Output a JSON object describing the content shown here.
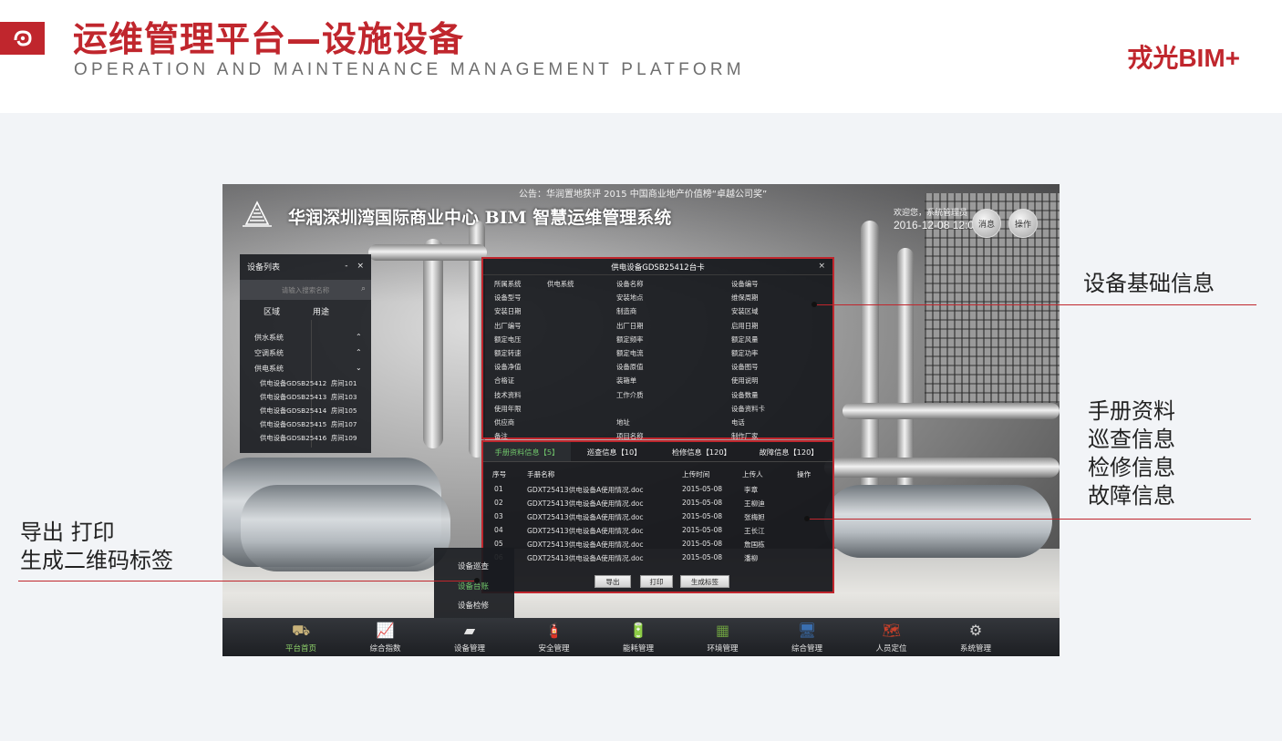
{
  "slide": {
    "title": "运维管理平台—设施设备",
    "subtitle": "OPERATION AND MAINTENANCE MANAGEMENT PLATFORM",
    "brand": "戎光BIM+",
    "logo_icon": "swirl-logo-icon",
    "accent_color": "#c0262d"
  },
  "app": {
    "notice": "公告：华润置地获评 2015 中国商业地产价值榜“卓越公司奖”",
    "title": "华润深圳湾国际商业中心 BIM 智慧运维管理系统",
    "welcome": "欢迎您，系统管理员",
    "datetime": "2016-12-08 12:00",
    "msg_button": "消息",
    "ops_button": "操作"
  },
  "device_list": {
    "title": "设备列表",
    "minimize": "-",
    "close": "×",
    "search_placeholder": "请输入搜索名称",
    "tabs": [
      "区域",
      "用途"
    ],
    "categories": [
      {
        "label": "供水系统",
        "chevron": "⌃"
      },
      {
        "label": "空调系统",
        "chevron": "⌃"
      },
      {
        "label": "供电系统",
        "chevron": "⌄"
      }
    ],
    "items": [
      {
        "name": "供电设备GDSB25412",
        "room": "房间101"
      },
      {
        "name": "供电设备GDSB25413",
        "room": "房间103"
      },
      {
        "name": "供电设备GDSB25414",
        "room": "房间105"
      },
      {
        "name": "供电设备GDSB25415",
        "room": "房间107"
      },
      {
        "name": "供电设备GDSB25416",
        "room": "房间109"
      }
    ]
  },
  "card": {
    "title": "供电设备GDSB25412台卡",
    "close": "×",
    "rows": [
      [
        "所属系统",
        "供电系统",
        "设备名称",
        "",
        "设备编号"
      ],
      [
        "设备型号",
        "",
        "安装地点",
        "",
        "维保周期"
      ],
      [
        "安装日期",
        "",
        "制造商",
        "",
        "安装区域"
      ],
      [
        "出厂编号",
        "",
        "出厂日期",
        "",
        "启用日期"
      ],
      [
        "额定电压",
        "",
        "额定频率",
        "",
        "额定风量"
      ],
      [
        "额定转速",
        "",
        "额定电流",
        "",
        "额定功率"
      ],
      [
        "设备净值",
        "",
        "设备原值",
        "",
        "设备图号"
      ],
      [
        "合格证",
        "",
        "装箱单",
        "",
        "使用说明"
      ],
      [
        "技术资料",
        "",
        "工作介质",
        "",
        "设备数量"
      ],
      [
        "使用年限",
        "",
        "",
        "",
        "设备资料卡"
      ],
      [
        "供应商",
        "",
        "地址",
        "",
        "电话"
      ],
      [
        "备注",
        "",
        "项目名称",
        "",
        "制作厂家"
      ]
    ]
  },
  "records": {
    "tabs": [
      "手册资料信息【5】",
      "巡查信息【10】",
      "检修信息【120】",
      "故障信息【120】"
    ],
    "active_tab": 0,
    "columns": [
      "序号",
      "手册名称",
      "上传时间",
      "上传人",
      "操作"
    ],
    "rows": [
      [
        "01",
        "GDXT25413供电设备A使用情况.doc",
        "2015-05-08",
        "李章",
        ""
      ],
      [
        "02",
        "GDXT25413供电设备A使用情况.doc",
        "2015-05-08",
        "王柳迪",
        ""
      ],
      [
        "03",
        "GDXT25413供电设备A使用情况.doc",
        "2015-05-08",
        "张梅妲",
        ""
      ],
      [
        "04",
        "GDXT25413供电设备A使用情况.doc",
        "2015-05-08",
        "王长江",
        ""
      ],
      [
        "05",
        "GDXT25413供电设备A使用情况.doc",
        "2015-05-08",
        "詹国栋",
        ""
      ],
      [
        "06",
        "GDXT25413供电设备A使用情况.doc",
        "2015-05-08",
        "潘柳",
        ""
      ]
    ],
    "buttons": [
      "导出",
      "打印",
      "生成标签"
    ]
  },
  "context_menu": {
    "items": [
      "设备巡查",
      "设备台账",
      "设备检修"
    ],
    "active_index": 1
  },
  "bottom_nav": {
    "items": [
      {
        "label": "平台首页",
        "icon": "home-platform-icon",
        "glyph": "⛟"
      },
      {
        "label": "综合指数",
        "icon": "chart-index-icon",
        "glyph": "📈"
      },
      {
        "label": "设备管理",
        "icon": "device-box-icon",
        "glyph": "▰"
      },
      {
        "label": "安全管理",
        "icon": "fire-extinguisher-icon",
        "glyph": "🧯"
      },
      {
        "label": "能耗管理",
        "icon": "battery-icon",
        "glyph": "🔋"
      },
      {
        "label": "环境管理",
        "icon": "circuit-board-icon",
        "glyph": "▦"
      },
      {
        "label": "综合管理",
        "icon": "monitor-icon",
        "glyph": "🖥"
      },
      {
        "label": "人员定位",
        "icon": "map-location-icon",
        "glyph": "🗺"
      },
      {
        "label": "系统管理",
        "icon": "gear-icon",
        "glyph": "⚙"
      }
    ],
    "active_index": 0,
    "active_color": "#8fd36b"
  },
  "annotations": {
    "basic_info": "设备基础信息",
    "records_info": [
      "手册资料",
      "巡查信息",
      "检修信息",
      "故障信息"
    ],
    "actions": [
      "导出  打印",
      "生成二维码标签"
    ]
  }
}
